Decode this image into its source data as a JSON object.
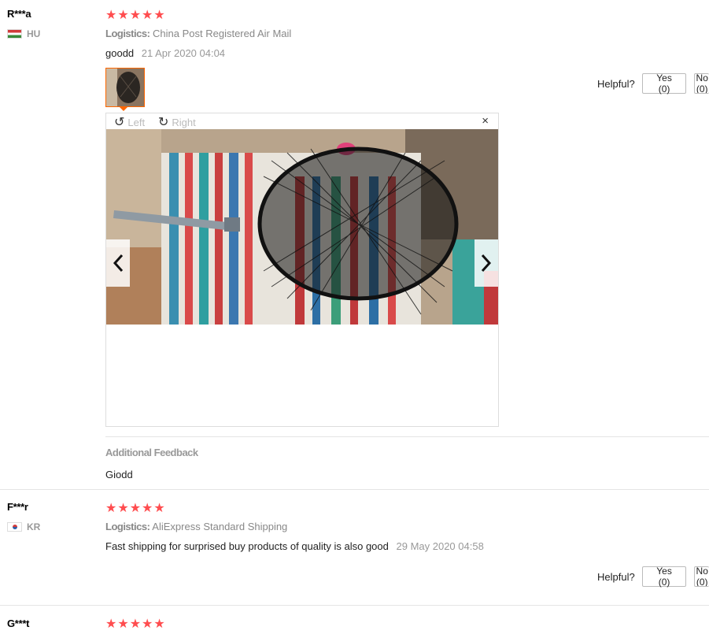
{
  "reviews": [
    {
      "username": "R***a",
      "country": "HU",
      "stars": "★★★★★",
      "logistics_label": "Logistics:",
      "logistics_value": " China Post Registered Air Mail",
      "text": "goodd",
      "date": "21 Apr 2020 04:04",
      "helpful_label": "Helpful?",
      "yes_label": "Yes (0)",
      "no_label": "No (0)",
      "viewer": {
        "rotate_left": "Left",
        "rotate_right": "Right",
        "close": "×"
      },
      "additional_title": "Additional Feedback",
      "additional_text": "Giodd"
    },
    {
      "username": "F***r",
      "country": "KR",
      "stars": "★★★★★",
      "logistics_label": "Logistics:",
      "logistics_value": " AliExpress Standard Shipping",
      "text": "Fast shipping for surprised buy products of quality is also good",
      "date": "29 May 2020 04:58",
      "helpful_label": "Helpful?",
      "yes_label": "Yes (0)",
      "no_label": "No (0)"
    },
    {
      "username": "G***t",
      "stars": "★★★★★"
    }
  ],
  "colors": {
    "star": "#ff4d4f",
    "thumb_border": "#ff6600"
  }
}
